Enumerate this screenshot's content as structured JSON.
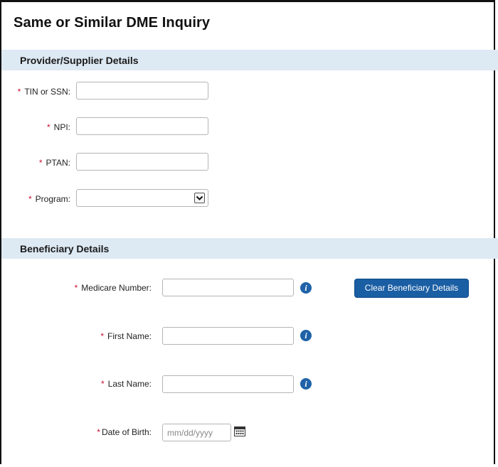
{
  "page": {
    "title": "Same or Similar DME Inquiry"
  },
  "provider_section": {
    "title": "Provider/Supplier Details",
    "fields": {
      "tin": {
        "label": "TIN or SSN:",
        "value": ""
      },
      "npi": {
        "label": "NPI:",
        "value": ""
      },
      "ptan": {
        "label": "PTAN:",
        "value": ""
      },
      "program": {
        "label": "Program:",
        "selected": ""
      }
    }
  },
  "beneficiary_section": {
    "title": "Beneficiary Details",
    "clear_button_label": "Clear Beneficiary Details",
    "fields": {
      "medicare_number": {
        "label": "Medicare Number:",
        "value": ""
      },
      "first_name": {
        "label": "First Name:",
        "value": ""
      },
      "last_name": {
        "label": "Last Name:",
        "value": ""
      },
      "date_of_birth": {
        "label": "Date of Birth:",
        "value": "",
        "placeholder": "mm/dd/yyyy"
      }
    }
  },
  "required_marker": "*",
  "icons": {
    "info": "info-icon",
    "calendar": "calendar-icon",
    "dropdown": "chevron-down-icon"
  },
  "colors": {
    "section_bar": "#dde9f3",
    "required": "#c8102e",
    "primary_button": "#1a5ea4",
    "info_icon": "#1f62a7"
  }
}
